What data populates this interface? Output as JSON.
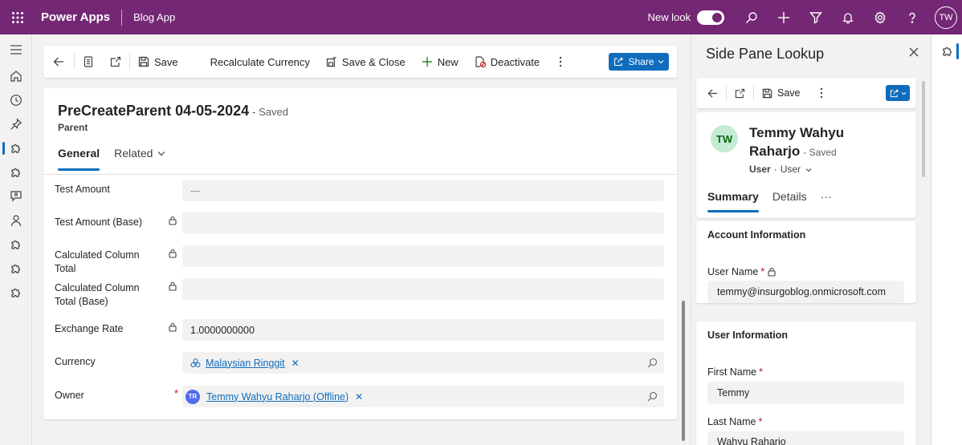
{
  "topbar": {
    "brand": "Power Apps",
    "app_name": "Blog App",
    "new_look_label": "New look",
    "user_initials": "TW",
    "bg_color": "#742774"
  },
  "command_bar": {
    "save": "Save",
    "recalculate": "Recalculate Currency",
    "save_close": "Save & Close",
    "new": "New",
    "deactivate": "Deactivate",
    "share": "Share"
  },
  "record": {
    "title": "PreCreateParent 04-05-2024",
    "status": "- Saved",
    "entity": "Parent",
    "tabs": [
      "General",
      "Related"
    ]
  },
  "fields": [
    {
      "label": "Test Amount",
      "value": "---",
      "locked": false
    },
    {
      "label": "Test Amount (Base)",
      "value": "",
      "locked": true
    },
    {
      "label": "Calculated Column Total",
      "value": "",
      "locked": true
    },
    {
      "label": "Calculated Column Total (Base)",
      "value": "",
      "locked": true
    },
    {
      "label": "Exchange Rate",
      "value": "1.0000000000",
      "locked": true
    },
    {
      "label": "Currency",
      "value": "Malaysian Ringgit",
      "locked": false
    },
    {
      "label": "Owner",
      "value": "Temmy Wahyu Raharjo (Offline)",
      "initials": "TR",
      "required": true
    }
  ],
  "side_pane": {
    "title": "Side Pane Lookup",
    "save": "Save",
    "avatar_initials": "TW",
    "name": "Temmy Wahyu Raharjo",
    "status": "- Saved",
    "entity": "User",
    "separator": "·",
    "form": "User",
    "tabs": [
      "Summary",
      "Details",
      "···"
    ],
    "sections": [
      {
        "title": "Account Information",
        "fields": [
          {
            "label": "User Name",
            "value": "temmy@insurgoblog.onmicrosoft.com",
            "required": true,
            "locked": true
          }
        ]
      },
      {
        "title": "User Information",
        "fields": [
          {
            "label": "First Name",
            "value": "Temmy",
            "required": true
          },
          {
            "label": "Last Name",
            "value": "Wahyu Raharjo",
            "required": true
          }
        ]
      }
    ]
  },
  "colors": {
    "accent": "#0f6cbd",
    "required": "#c50f1f"
  }
}
